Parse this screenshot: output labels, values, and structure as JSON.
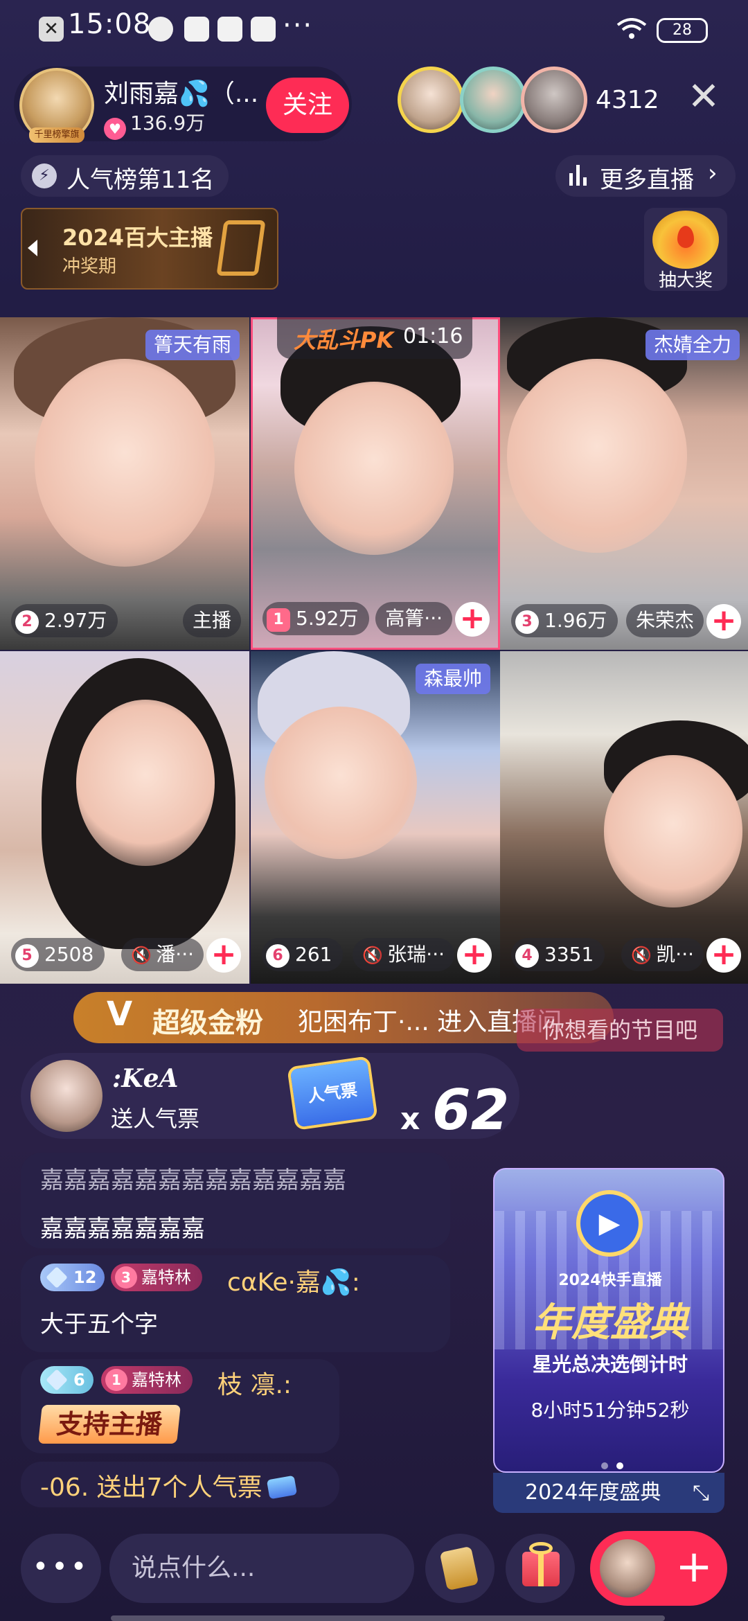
{
  "status_bar": {
    "time": "15:08",
    "icons": [
      "close-icon",
      "music-icon",
      "message-icon",
      "mail-icon",
      "mail-icon"
    ],
    "more": "···",
    "battery": "28"
  },
  "host": {
    "name": "刘雨嘉💦（...",
    "likes": "136.9万",
    "follow_label": "关注",
    "badge": "千里榜擎旗"
  },
  "viewers": {
    "count": "4312"
  },
  "rank": {
    "label": "人气榜第11名"
  },
  "more_live": {
    "label": "更多直播"
  },
  "event_banner": {
    "title": "2024百大主播",
    "subtitle": "冲奖期"
  },
  "lottery": {
    "label": "抽大奖"
  },
  "pk": {
    "mode_label": "大乱斗PK",
    "timer": "01:16",
    "tiles": [
      {
        "tag": "箐天有雨",
        "rank": "2",
        "score": "2.97万",
        "name": "主播",
        "muted": false,
        "addable": false
      },
      {
        "tag": "",
        "rank": "1",
        "score": "5.92万",
        "name": "高箐···",
        "muted": false,
        "addable": true
      },
      {
        "tag": "杰婧全力",
        "rank": "3",
        "score": "1.96万",
        "name": "朱荣杰",
        "muted": false,
        "addable": true
      },
      {
        "tag": "",
        "rank": "5",
        "score": "2508",
        "name": "潘···",
        "muted": true,
        "addable": true
      },
      {
        "tag": "森最帅",
        "rank": "6",
        "score": "261",
        "name": "张瑞···",
        "muted": true,
        "addable": true
      },
      {
        "tag": "",
        "rank": "4",
        "score": "3351",
        "name": "凯···",
        "muted": true,
        "addable": true
      }
    ]
  },
  "join_banner": {
    "v": "V",
    "title": "超级金粉",
    "text": "犯困布丁·... 进入直播间"
  },
  "suggestion": "你想看的节目吧",
  "gift": {
    "user": ":𝑲𝒆𝑨",
    "action": "送人气票",
    "icon_label": "人气票",
    "x": "x",
    "count": "62"
  },
  "chat": {
    "line1": "嘉嘉嘉嘉嘉嘉嘉嘉嘉嘉嘉嘉嘉",
    "line2": "嘉嘉嘉嘉嘉嘉嘉",
    "msg2": {
      "level": "12",
      "fan_level": "3",
      "fan_club": "嘉特林",
      "user": "cαKe·嘉💦:",
      "text": "大于五个字"
    },
    "msg3": {
      "level": "6",
      "fan_level": "1",
      "fan_club": "嘉特林",
      "user": "枝 凛.:",
      "text": "支持主播"
    },
    "msg4": {
      "text": "-06. 送出7个人气票"
    }
  },
  "promo": {
    "small": "2024快手直播",
    "big": "年度盛典",
    "sub": "星光总决选倒计时",
    "countdown": "8小时51分钟52秒",
    "bar_label": "2024年度盛典"
  },
  "bottom_bar": {
    "more": "•••",
    "input_placeholder": "说点什么..."
  },
  "colors": {
    "accent": "#fe2c55",
    "background": "#221d45",
    "username": "#ffd27a"
  }
}
